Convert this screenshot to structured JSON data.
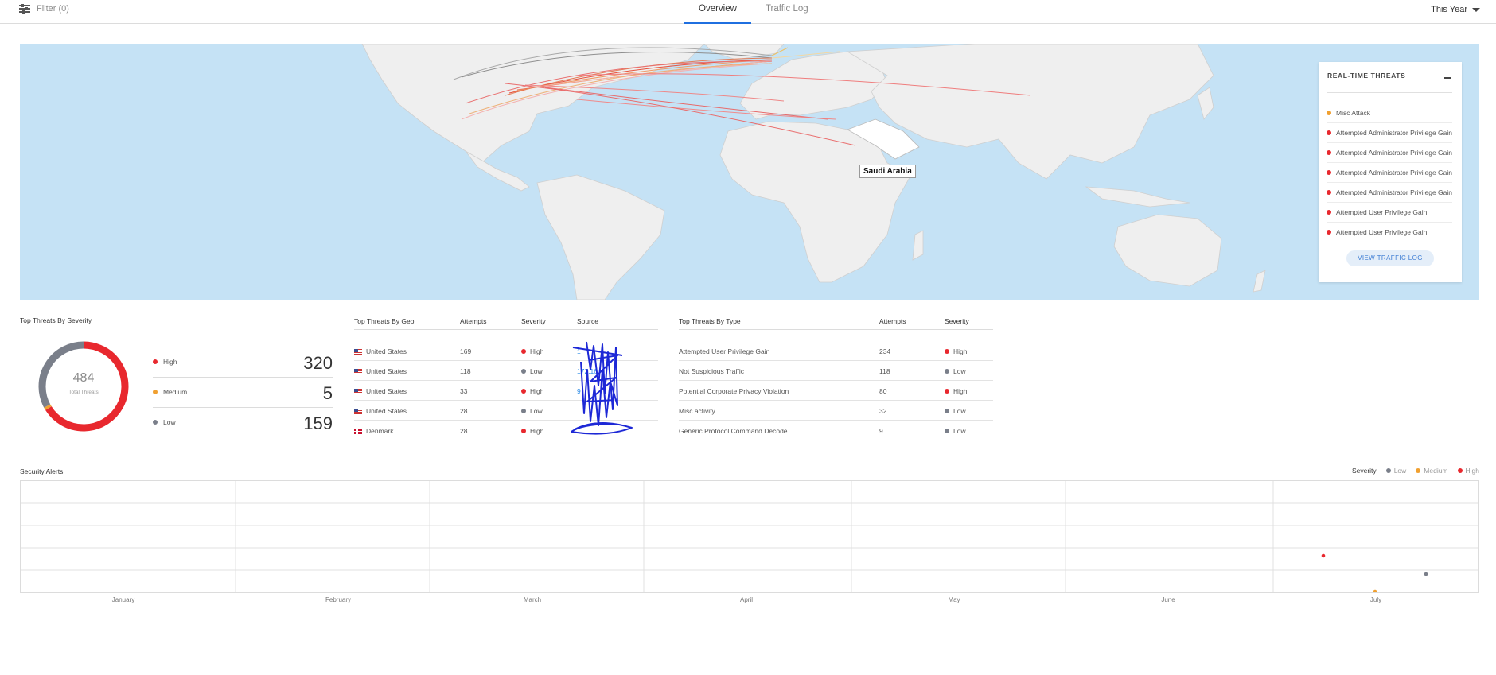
{
  "header": {
    "filter_label": "Filter (0)",
    "tabs": [
      {
        "label": "Overview",
        "active": true
      },
      {
        "label": "Traffic Log",
        "active": false
      }
    ],
    "period": "This Year"
  },
  "map": {
    "tooltip": "Saudi Arabia",
    "realtime": {
      "title": "REAL-TIME THREATS",
      "items": [
        {
          "label": "Misc Attack",
          "severity": "medium"
        },
        {
          "label": "Attempted Administrator Privilege Gain",
          "severity": "high"
        },
        {
          "label": "Attempted Administrator Privilege Gain",
          "severity": "high"
        },
        {
          "label": "Attempted Administrator Privilege Gain",
          "severity": "high"
        },
        {
          "label": "Attempted Administrator Privilege Gain",
          "severity": "high"
        },
        {
          "label": "Attempted User Privilege Gain",
          "severity": "high"
        },
        {
          "label": "Attempted User Privilege Gain",
          "severity": "high"
        }
      ],
      "button": "VIEW TRAFFIC LOG"
    }
  },
  "colors": {
    "high": "#e8282e",
    "medium": "#f0a030",
    "low": "#7a7f8a"
  },
  "severity": {
    "title": "Top Threats By Severity",
    "total": "484",
    "total_label": "Total Threats",
    "rows": [
      {
        "label": "High",
        "value": "320",
        "key": "high"
      },
      {
        "label": "Medium",
        "value": "5",
        "key": "medium"
      },
      {
        "label": "Low",
        "value": "159",
        "key": "low"
      }
    ]
  },
  "geo": {
    "headers": [
      "Top Threats By Geo",
      "Attempts",
      "Severity",
      "Source"
    ],
    "rows": [
      {
        "country": "United States",
        "flag": "us",
        "attempts": "169",
        "severity": "High",
        "key": "high",
        "source": "1"
      },
      {
        "country": "United States",
        "flag": "us",
        "attempts": "118",
        "severity": "Low",
        "key": "low",
        "source": "172.16"
      },
      {
        "country": "United States",
        "flag": "us",
        "attempts": "33",
        "severity": "High",
        "key": "high",
        "source": "9"
      },
      {
        "country": "United States",
        "flag": "us",
        "attempts": "28",
        "severity": "Low",
        "key": "low",
        "source": ""
      },
      {
        "country": "Denmark",
        "flag": "dk",
        "attempts": "28",
        "severity": "High",
        "key": "high",
        "source": ""
      }
    ]
  },
  "types": {
    "headers": [
      "Top Threats By Type",
      "Attempts",
      "Severity"
    ],
    "rows": [
      {
        "type": "Attempted User Privilege Gain",
        "attempts": "234",
        "severity": "High",
        "key": "high"
      },
      {
        "type": "Not Suspicious Traffic",
        "attempts": "118",
        "severity": "Low",
        "key": "low"
      },
      {
        "type": "Potential Corporate Privacy Violation",
        "attempts": "80",
        "severity": "High",
        "key": "high"
      },
      {
        "type": "Misc activity",
        "attempts": "32",
        "severity": "Low",
        "key": "low"
      },
      {
        "type": "Generic Protocol Command Decode",
        "attempts": "9",
        "severity": "Low",
        "key": "low"
      }
    ]
  },
  "alerts": {
    "title": "Security Alerts",
    "legend_title": "Severity",
    "legend": [
      {
        "label": "Low",
        "key": "low"
      },
      {
        "label": "Medium",
        "key": "medium"
      },
      {
        "label": "High",
        "key": "high"
      }
    ],
    "months": [
      "January",
      "February",
      "March",
      "April",
      "May",
      "June",
      "July"
    ]
  }
}
